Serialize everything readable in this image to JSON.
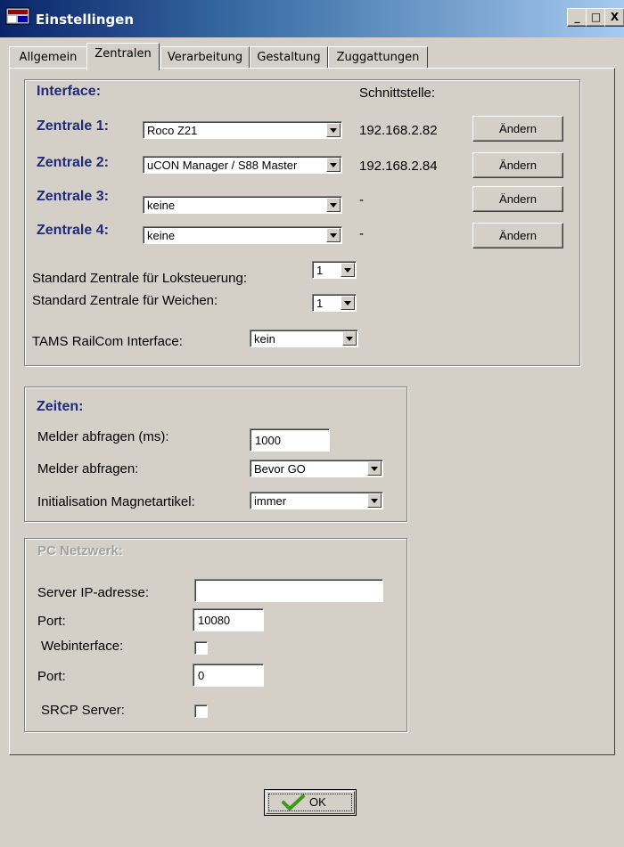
{
  "window": {
    "title": "Einstellingen",
    "controls": {
      "minimize": "_",
      "maximize": "□",
      "close": "X"
    }
  },
  "tabs": [
    {
      "label": "Allgemein"
    },
    {
      "label": "Zentralen"
    },
    {
      "label": "Verarbeitung"
    },
    {
      "label": "Gestaltung"
    },
    {
      "label": "Zuggattungen"
    }
  ],
  "active_tab": "Zentralen",
  "interface": {
    "title": "Interface:",
    "schnittstelle_header": "Schnittstelle:",
    "rows": [
      {
        "label": "Zentrale 1:",
        "value": "Roco Z21",
        "address": "192.168.2.82",
        "button": "Ändern"
      },
      {
        "label": "Zentrale 2:",
        "value": "uCON Manager / S88 Master",
        "address": "192.168.2.84",
        "button": "Ändern"
      },
      {
        "label": "Zentrale 3:",
        "value": "keine",
        "address": "-",
        "button": "Ändern"
      },
      {
        "label": "Zentrale 4:",
        "value": "keine",
        "address": "-",
        "button": "Ändern"
      }
    ],
    "standard_loco_label": "Standard Zentrale für Loksteuerung:",
    "standard_loco_value": "1",
    "standard_switch_label": "Standard Zentrale für Weichen:",
    "standard_switch_value": "1",
    "railcom_label": "TAMS RailCom Interface:",
    "railcom_value": "kein"
  },
  "zeiten": {
    "title": "Zeiten:",
    "poll_ms_label": "Melder abfragen (ms):",
    "poll_ms_value": "1000",
    "poll_label": "Melder abfragen:",
    "poll_value": "Bevor GO",
    "init_label": "Initialisation Magnetartikel:",
    "init_value": "immer"
  },
  "netzwerk": {
    "title": "PC Netzwerk:",
    "server_ip_label": "Server IP-adresse:",
    "server_ip_value": "",
    "port_label": "Port:",
    "port_value": "10080",
    "webinterface_label": "Webinterface:",
    "webinterface_checked": false,
    "port2_label": "Port:",
    "port2_value": "0",
    "srcp_label": "SRCP Server:",
    "srcp_checked": false
  },
  "ok_button": {
    "label": "OK",
    "icon": "checkmark-icon"
  },
  "colors": {
    "titlebar_start": "#0a246a",
    "titlebar_end": "#a6caf0",
    "group_title": "#1f2a7a",
    "dialog_bg": "#d4d0c8"
  }
}
